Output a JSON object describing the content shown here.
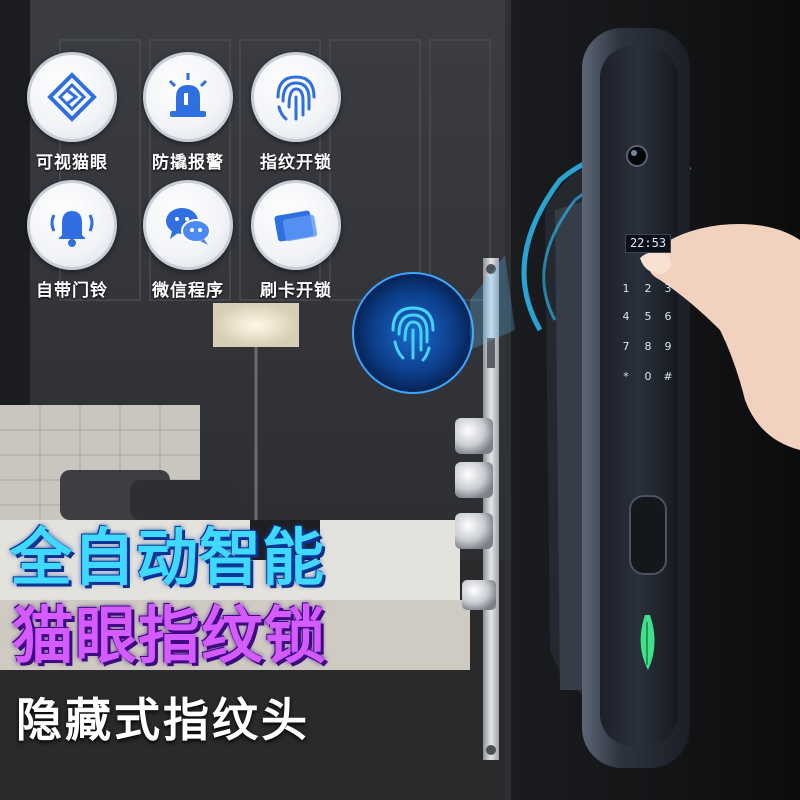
{
  "features": [
    {
      "label": "可视猫眼",
      "icon": "peephole-icon"
    },
    {
      "label": "防撬报警",
      "icon": "alarm-light-icon"
    },
    {
      "label": "指纹开锁",
      "icon": "fingerprint-icon"
    },
    {
      "label": "自带门铃",
      "icon": "doorbell-icon"
    },
    {
      "label": "微信程序",
      "icon": "wechat-icon"
    },
    {
      "label": "刷卡开锁",
      "icon": "card-icon"
    }
  ],
  "headline": {
    "line1": "全自动智能",
    "line2": "猫眼指纹锁",
    "line3": "隐藏式指纹头"
  },
  "lock": {
    "clock": "22:53",
    "keypad": [
      "1",
      "2",
      "3",
      "4",
      "5",
      "6",
      "7",
      "8",
      "9",
      "*",
      "0",
      "#"
    ]
  },
  "colors": {
    "icon_blue": "#2f6fe0",
    "headline_cyan": "#3fd8ff",
    "headline_purple": "#d45cff",
    "fingerprint_glow": "#2ec6ff",
    "lock_body": "#3a4250"
  }
}
